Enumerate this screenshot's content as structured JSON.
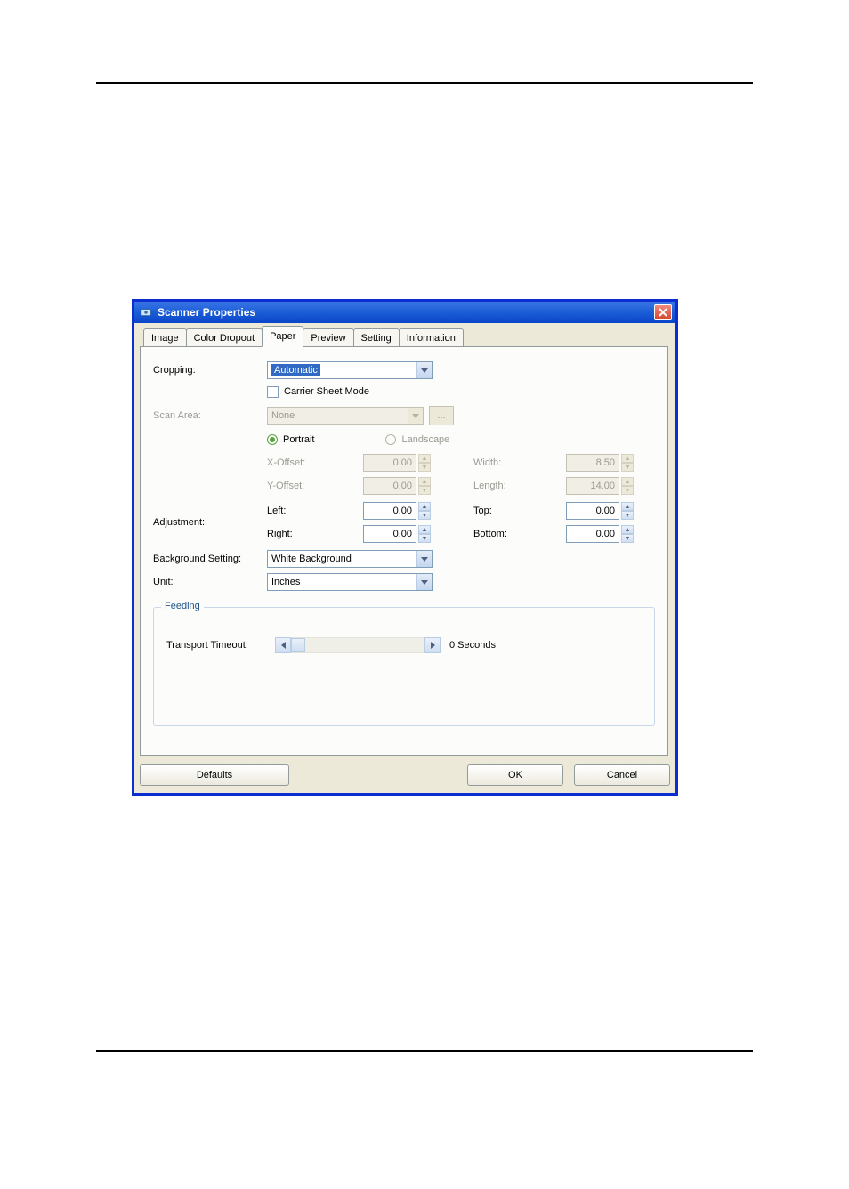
{
  "window": {
    "title": "Scanner Properties"
  },
  "tabs": [
    "Image",
    "Color Dropout",
    "Paper",
    "Preview",
    "Setting",
    "Information"
  ],
  "active_tab_index": 2,
  "labels": {
    "cropping": "Cropping:",
    "carrier_sheet_mode": "Carrier Sheet Mode",
    "scan_area": "Scan Area:",
    "portrait": "Portrait",
    "landscape": "Landscape",
    "x_offset": "X-Offset:",
    "y_offset": "Y-Offset:",
    "width": "Width:",
    "length": "Length:",
    "adjustment": "Adjustment:",
    "left": "Left:",
    "right": "Right:",
    "top": "Top:",
    "bottom": "Bottom:",
    "bg_setting": "Background Setting:",
    "unit": "Unit:",
    "feeding": "Feeding",
    "transport_timeout": "Transport Timeout:",
    "dots": "..."
  },
  "values": {
    "cropping": "Automatic",
    "scan_area": "None",
    "x_offset": "0.00",
    "y_offset": "0.00",
    "width": "8.50",
    "length": "14.00",
    "adj_left": "0.00",
    "adj_right": "0.00",
    "adj_top": "0.00",
    "adj_bottom": "0.00",
    "bg_setting": "White Background",
    "unit": "Inches",
    "timeout_display": "0 Seconds"
  },
  "buttons": {
    "defaults": "Defaults",
    "ok": "OK",
    "cancel": "Cancel"
  }
}
